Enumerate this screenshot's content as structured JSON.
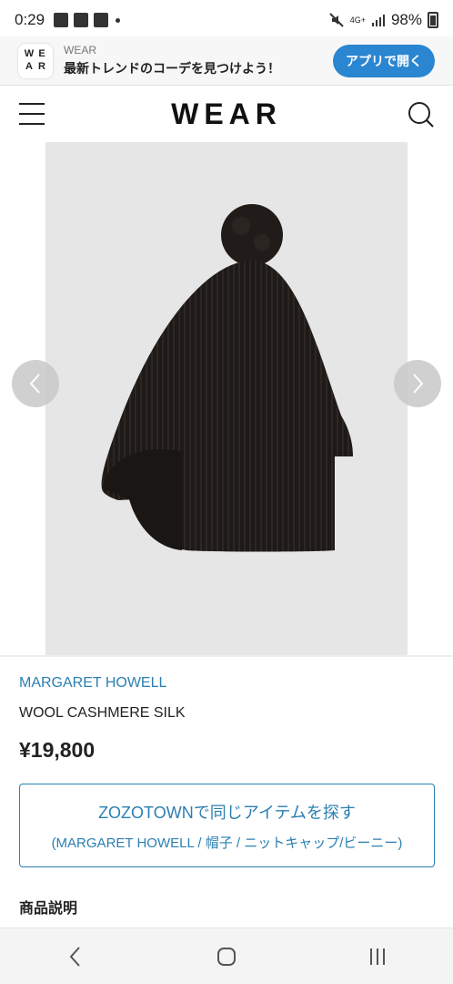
{
  "status_bar": {
    "time": "0:29",
    "network": "4G+",
    "battery": "98%"
  },
  "app_banner": {
    "logo_letters": [
      "W",
      "E",
      "A",
      "R"
    ],
    "app_name": "WEAR",
    "tagline": "最新トレンドのコーデを見つけよう！",
    "open_button": "アプリで開く"
  },
  "header": {
    "logo": "WEAR"
  },
  "product": {
    "brand": "MARGARET HOWELL",
    "name": "WOOL CASHMERE SILK",
    "price": "¥19,800"
  },
  "zozo_link": {
    "main": "ZOZOTOWNで同じアイテムを探す",
    "sub": "(MARGARET HOWELL / 帽子 / ニットキャップ/ビーニー)"
  },
  "section": {
    "description_title": "商品説明"
  },
  "colors": {
    "accent": "#2b7fb0",
    "banner_button": "#2a86d0",
    "image_background": "#e6e6e6"
  }
}
